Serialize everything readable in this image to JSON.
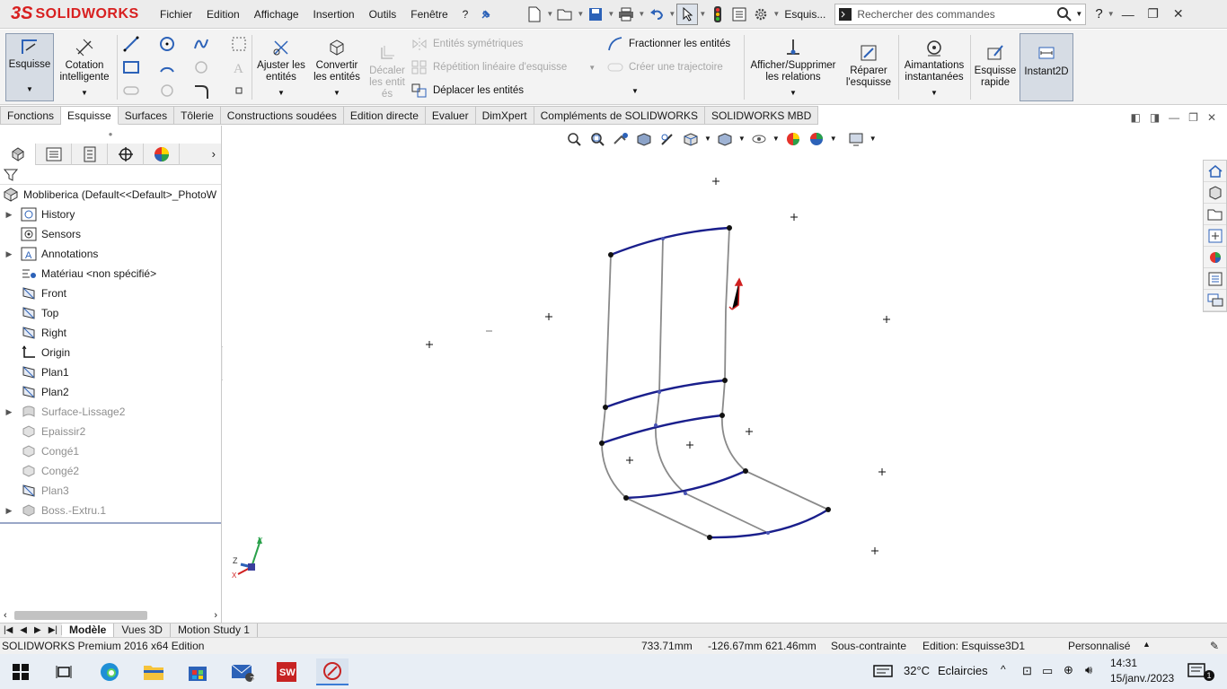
{
  "app": {
    "brand_prefix": "3S",
    "brand": "SOLIDWORKS",
    "menus": [
      "Fichier",
      "Edition",
      "Affichage",
      "Insertion",
      "Outils",
      "Fenêtre",
      "?"
    ],
    "quick_label": "Esquis...",
    "search_placeholder": "Rechercher des commandes",
    "help": "?"
  },
  "ribbon": {
    "esquisse": "Esquisse",
    "cotation": "Cotation intelligente",
    "ajuster": "Ajuster les entités",
    "convertir": "Convertir les entités",
    "decaler": "Décaler les entit és",
    "symetriques": "Entités symétriques",
    "repetition": "Répétition linéaire d'esquisse",
    "deplacer": "Déplacer les entités",
    "fractionner": "Fractionner les entités",
    "trajectoire": "Créer une trajectoire",
    "relations": "Afficher/Supprimer les relations",
    "reparer": "Réparer l'esquisse",
    "aimantations": "Aimantations instantanées",
    "rapide": "Esquisse rapide",
    "instant2d": "Instant2D"
  },
  "tabs": [
    "Fonctions",
    "Esquisse",
    "Surfaces",
    "Tôlerie",
    "Constructions soudées",
    "Edition directe",
    "Evaluer",
    "DimXpert",
    "Compléments de SOLIDWORKS",
    "SOLIDWORKS MBD"
  ],
  "active_tab": "Esquisse",
  "tree": {
    "root": "Mobliberica  (Default<<Default>_PhotoW",
    "items": [
      {
        "label": "History",
        "icon": "history-icon",
        "expand": true,
        "grey": false
      },
      {
        "label": "Sensors",
        "icon": "sensor-icon",
        "expand": false,
        "grey": false
      },
      {
        "label": "Annotations",
        "icon": "annotation-icon",
        "expand": true,
        "grey": false
      },
      {
        "label": "Matériau <non spécifié>",
        "icon": "material-icon",
        "expand": false,
        "grey": false
      },
      {
        "label": "Front",
        "icon": "plane-icon",
        "expand": false,
        "grey": false
      },
      {
        "label": "Top",
        "icon": "plane-icon",
        "expand": false,
        "grey": false
      },
      {
        "label": "Right",
        "icon": "plane-icon",
        "expand": false,
        "grey": false
      },
      {
        "label": "Origin",
        "icon": "origin-icon",
        "expand": false,
        "grey": false
      },
      {
        "label": "Plan1",
        "icon": "plane-icon",
        "expand": false,
        "grey": false
      },
      {
        "label": "Plan2",
        "icon": "plane-icon",
        "expand": false,
        "grey": false
      },
      {
        "label": "Surface-Lissage2",
        "icon": "surface-icon",
        "expand": true,
        "grey": true
      },
      {
        "label": "Epaissir2",
        "icon": "feature-icon",
        "expand": false,
        "grey": true
      },
      {
        "label": "Congé1",
        "icon": "fillet-icon",
        "expand": false,
        "grey": true
      },
      {
        "label": "Congé2",
        "icon": "fillet-icon",
        "expand": false,
        "grey": true
      },
      {
        "label": "Plan3",
        "icon": "plane-icon",
        "expand": false,
        "grey": true
      },
      {
        "label": "Boss.-Extru.1",
        "icon": "extrude-icon",
        "expand": true,
        "grey": true
      }
    ]
  },
  "bottom_tabs": [
    "Modèle",
    "Vues 3D",
    "Motion Study 1"
  ],
  "status": {
    "product": "SOLIDWORKS Premium 2016 x64 Edition",
    "x": "733.71mm",
    "yz": "-126.67mm 621.46mm",
    "state": "Sous-contrainte",
    "editing": "Edition: Esquisse3D1",
    "custom": "Personnalisé"
  },
  "taskbar": {
    "badge": "7",
    "temp": "32°C",
    "weather": "Eclaircies",
    "time": "14:31",
    "date": "15/janv./2023",
    "notif": "1"
  },
  "triad": {
    "x": "X",
    "y": "Y",
    "z": "Z"
  },
  "colors": {
    "sketch_curve": "#1a1f8c",
    "guide": "#8a8a8a",
    "brand": "#d82020",
    "accent": "#3a7bd5"
  }
}
